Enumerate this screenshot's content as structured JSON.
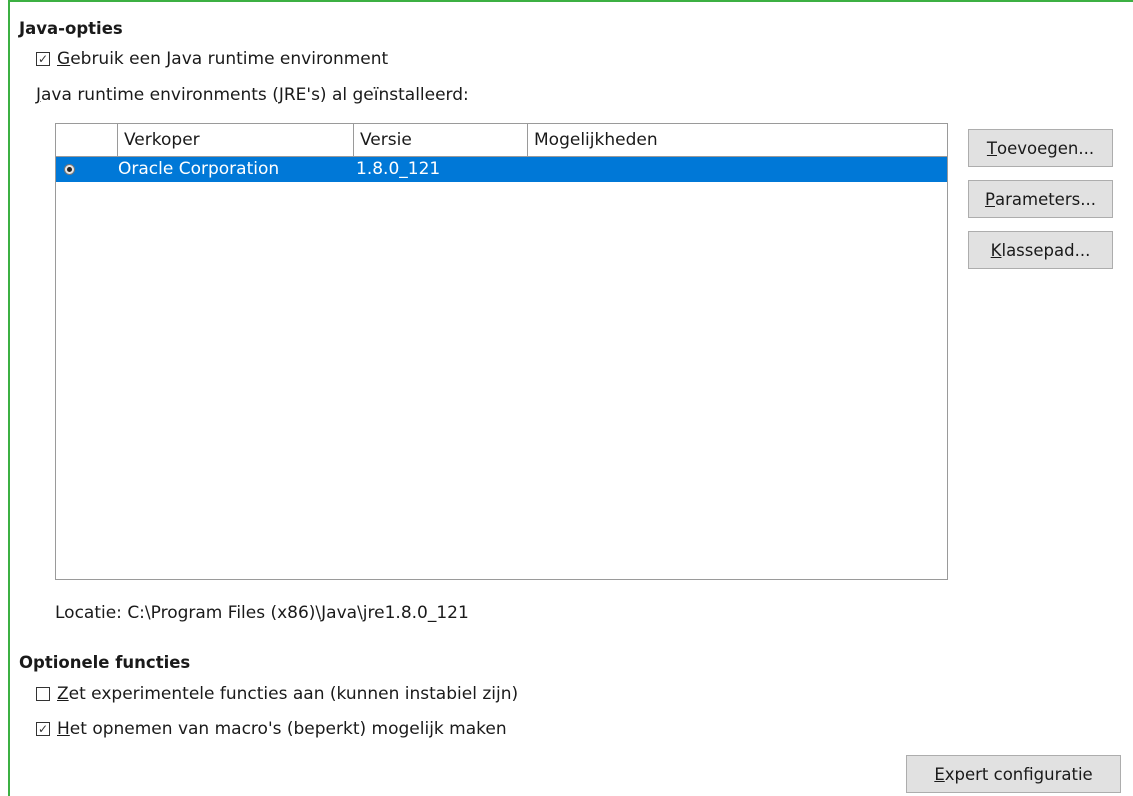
{
  "java": {
    "section_title": "Java-opties",
    "use_jre": {
      "checked": true,
      "mn": "G",
      "rest": "ebruik een Java runtime environment"
    },
    "installed_label": {
      "mn": "J",
      "rest": "ava runtime environments (JRE's) al geïnstalleerd:"
    },
    "table": {
      "columns": [
        "",
        "Verkoper",
        "Versie",
        "Mogelijkheden"
      ],
      "rows": [
        {
          "selected": true,
          "vendor": "Oracle Corporation",
          "version": "1.8.0_121",
          "features": ""
        }
      ]
    },
    "location": "Locatie: C:\\Program Files (x86)\\Java\\jre1.8.0_121",
    "buttons": {
      "add": {
        "mn": "T",
        "rest": "oevoegen..."
      },
      "parameters": {
        "mn": "P",
        "rest": "arameters..."
      },
      "classpath": {
        "mn": "K",
        "rest": "lassepad..."
      }
    }
  },
  "optional": {
    "section_title": "Optionele functies",
    "experimental": {
      "checked": false,
      "mn": "Z",
      "rest": "et experimentele functies aan (kunnen instabiel zijn)"
    },
    "macro": {
      "checked": true,
      "mn": "H",
      "rest": "et opnemen van macro's (beperkt) mogelijk maken"
    },
    "expert_button": {
      "mn": "E",
      "rest": "xpert configuratie"
    }
  },
  "check_glyph": "☑",
  "colors": {
    "selection": "#0078d7",
    "frame": "#3cb043"
  }
}
